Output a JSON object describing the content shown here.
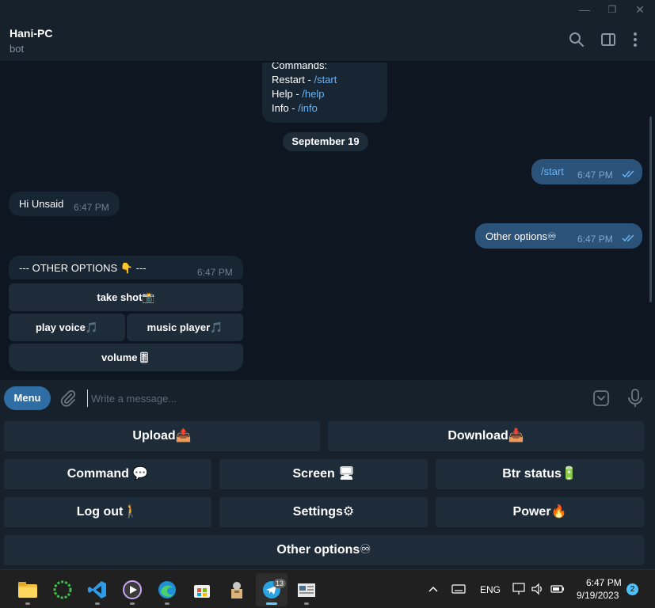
{
  "window": {
    "minimize": "—",
    "maximize": "❐",
    "close": "✕"
  },
  "header": {
    "title": "Hani-PC",
    "status": "bot"
  },
  "messages": {
    "commands_intro": "Commands:",
    "cmd1_label": "Restart - ",
    "cmd1_link": "/start",
    "cmd2_label": "Help - ",
    "cmd2_link": "/help",
    "cmd3_label": "Info - ",
    "cmd3_link": "/info",
    "date_separator": "September 19",
    "out1_text": "/start",
    "out1_time": "6:47 PM",
    "in1_text": "Hi Unsaid",
    "in1_time": "6:47 PM",
    "out2_text": "Other options♾",
    "out2_time": "6:47 PM",
    "in2_text": "---  OTHER OPTIONS 👇 ---",
    "in2_time": "6:47 PM"
  },
  "inline_keyboard": {
    "take_shot": "take shot📸",
    "play_voice": "play voice🎵",
    "music_player": "music player🎵",
    "volume": "volume🎚"
  },
  "input": {
    "menu_label": "Menu",
    "placeholder": "Write a message..."
  },
  "reply_keyboard": {
    "upload": "Upload📤",
    "download": "Download📥",
    "command": "Command 💬",
    "screen": "Screen 🖥",
    "btr_status": "Btr status🔋",
    "log_out": "Log out🚶",
    "settings": "Settings⚙",
    "power": "Power🔥",
    "other_options": "Other options♾"
  },
  "taskbar": {
    "telegram_badge": "13",
    "language": "ENG",
    "clock_time": "6:47 PM",
    "clock_date": "9/19/2023",
    "notification_count": "2"
  },
  "colors": {
    "chat_bg": "#0e1621",
    "panel_bg": "#17212b",
    "incoming_bubble": "#182533",
    "outgoing_bubble": "#2b5278",
    "link": "#6ab3f3",
    "button_bg": "#1e2c3a",
    "menu_button": "#2f6ea5"
  }
}
